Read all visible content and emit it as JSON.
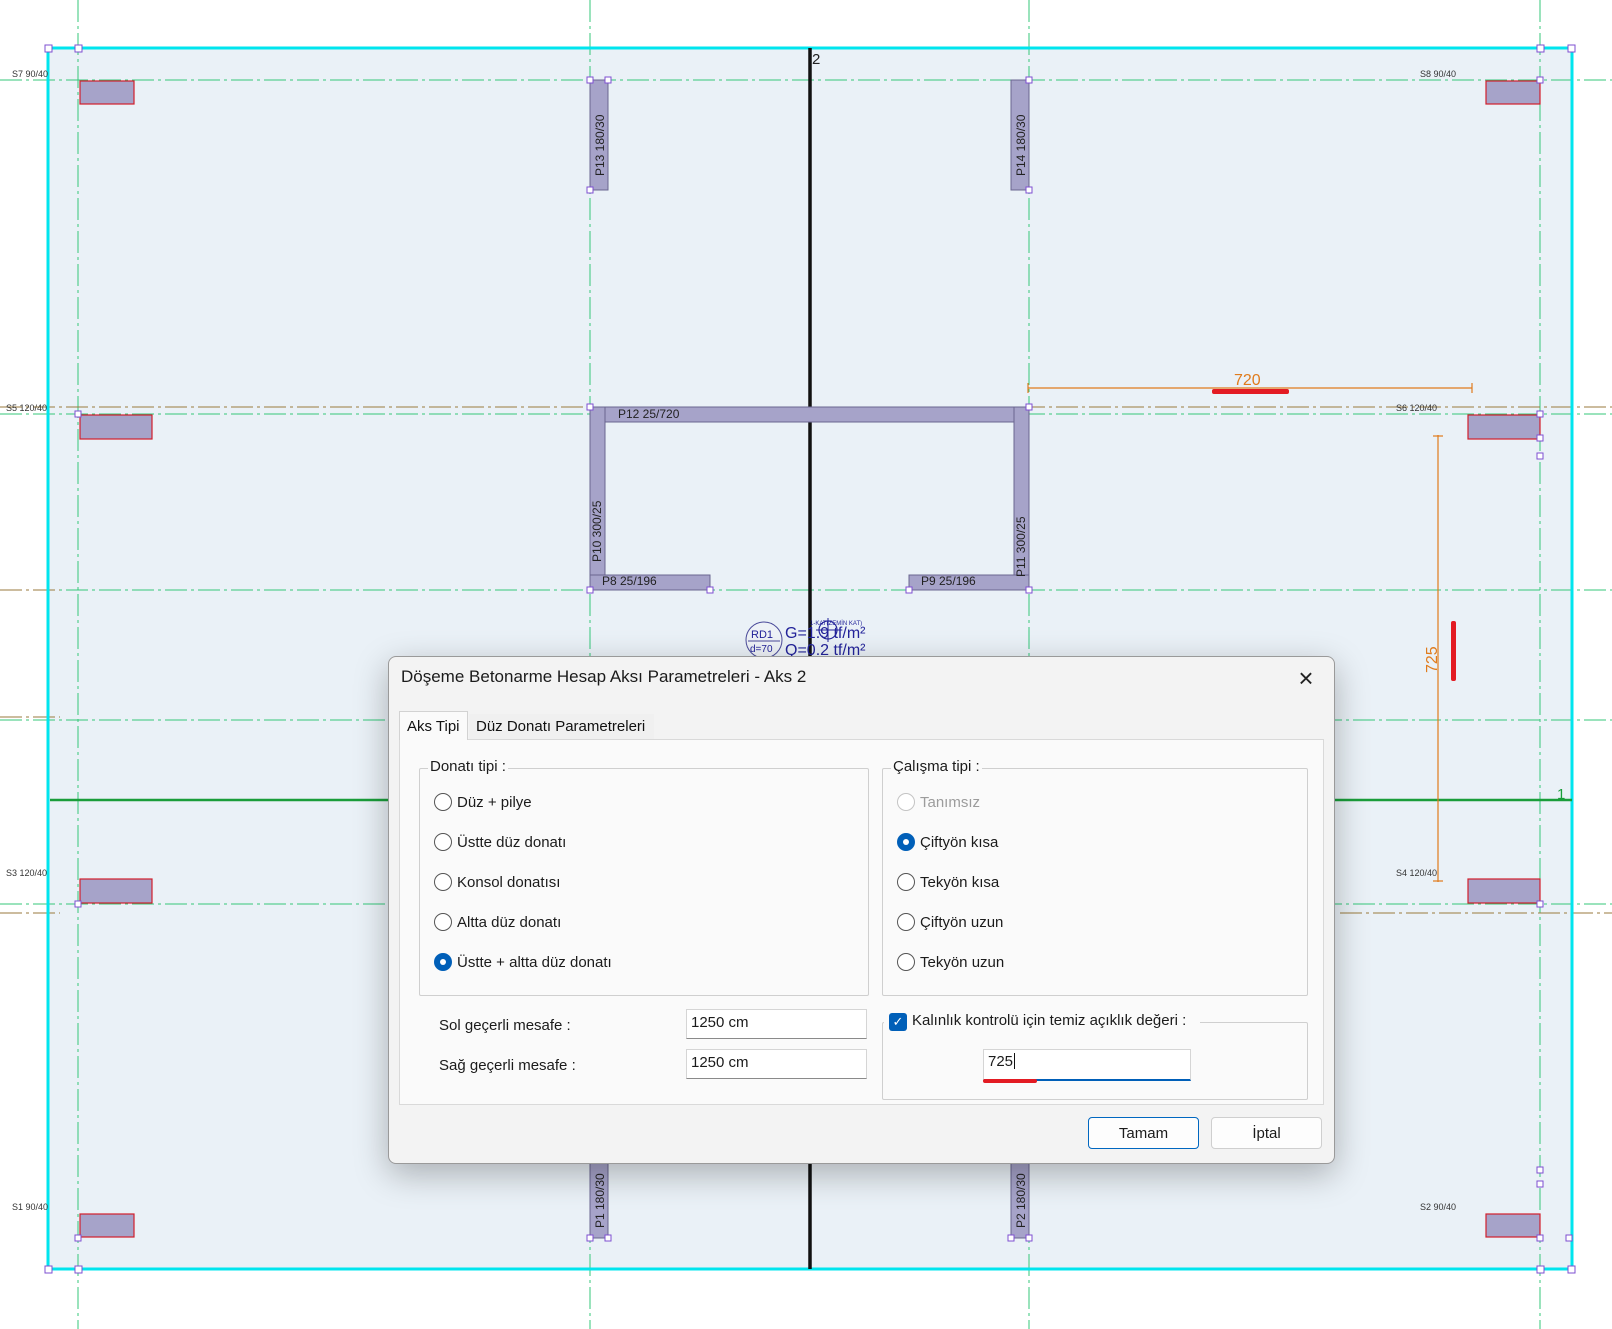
{
  "canvas": {
    "axis_numbers": {
      "axis2": "2",
      "axis1": "1"
    },
    "labels": {
      "s7": "S7 90/40",
      "s8": "S8 90/40",
      "s5": "S5 120/40",
      "s6": "S6 120/40",
      "s3": "S3 120/40",
      "s4": "S4 120/40",
      "s1": "S1 90/40",
      "s2": "S2 90/40",
      "p13": "P13 180/30",
      "p14": "P14 180/30",
      "p12": "P12 25/720",
      "p10": "P10 300/25",
      "p11": "P11 300/25",
      "p8": "P8 25/196",
      "p9": "P9 25/196",
      "p1": "P1 180/30",
      "p2": "P2 180/30"
    },
    "dimension_h": "720",
    "dimension_v": "725",
    "slab_id": "RD1",
    "slab_thickness": "d=70",
    "load_g": "G=1.9 tf/m²",
    "load_q": "Q=0.2 tf/m²",
    "floor_note": "1-KAT(ZEMİN KAT)",
    "colors": {
      "frame": "#00e5ee",
      "axis_line": "#1a9d3a",
      "element_fill": "#a6a3c9",
      "column_border": "#d21e2b",
      "dimension": "#e07b1c",
      "highlight": "#e31b23"
    }
  },
  "dialog": {
    "title": "Döşeme Betonarme Hesap Aksı Parametreleri - Aks 2",
    "close_icon": "close-icon",
    "tabs": [
      "Aks Tipi",
      "Düz Donatı Parametreleri"
    ],
    "rebar_group": {
      "label": "Donatı tipi :",
      "options": [
        "Düz + pilye",
        "Üstte düz donatı",
        "Konsol donatısı",
        "Altta düz donatı",
        "Üstte + altta düz donatı"
      ],
      "selected": "Üstte + altta düz donatı"
    },
    "work_group": {
      "label": "Çalışma tipi :",
      "options": [
        "Tanımsız",
        "Çiftyön kısa",
        "Tekyön kısa",
        "Çiftyön uzun",
        "Tekyön uzun"
      ],
      "selected": "Çiftyön kısa",
      "disabled": [
        "Tanımsız"
      ]
    },
    "left_distance": {
      "label": "Sol geçerli mesafe :",
      "value": "1250 cm"
    },
    "right_distance": {
      "label": "Sağ geçerli mesafe :",
      "value": "1250 cm"
    },
    "thickness_check": {
      "label": "Kalınlık kontrolü için temiz açıklık değeri :",
      "checked": true,
      "value": "725"
    },
    "ok_label": "Tamam",
    "cancel_label": "İptal"
  }
}
